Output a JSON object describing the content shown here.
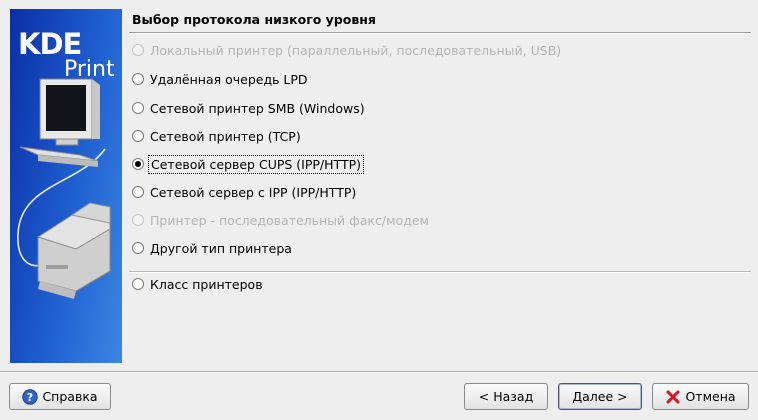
{
  "side_panel": {
    "brand_top": "KDE",
    "brand_bottom": "Print"
  },
  "page": {
    "title": "Выбор протокола низкого уровня"
  },
  "options": [
    {
      "label": "Локальный принтер (параллельный, последовательный, USB)",
      "state": "disabled"
    },
    {
      "label": "Удалённая очередь LPD",
      "state": "normal"
    },
    {
      "label": "Сетевой принтер SMB (Windows)",
      "state": "normal"
    },
    {
      "label": "Сетевой принтер (TCP)",
      "state": "normal"
    },
    {
      "label": "Сетевой сервер CUPS (IPP/HTTP)",
      "state": "selected"
    },
    {
      "label": "Сетевой сервер с IPP (IPP/HTTP)",
      "state": "normal"
    },
    {
      "label": "Принтер - последовательный факс/модем",
      "state": "disabled"
    },
    {
      "label": "Другой тип принтера",
      "state": "normal"
    },
    {
      "label": "Класс принтеров",
      "state": "normal"
    }
  ],
  "buttons": {
    "help": "Справка",
    "back": "< Назад",
    "next": "Далее >",
    "cancel": "Отмена"
  },
  "icons": {
    "help": "help-icon",
    "cancel": "cancel-icon"
  },
  "colors": {
    "panel_blue": "#1f5fd0",
    "disabled_text": "#b4b4b4"
  }
}
